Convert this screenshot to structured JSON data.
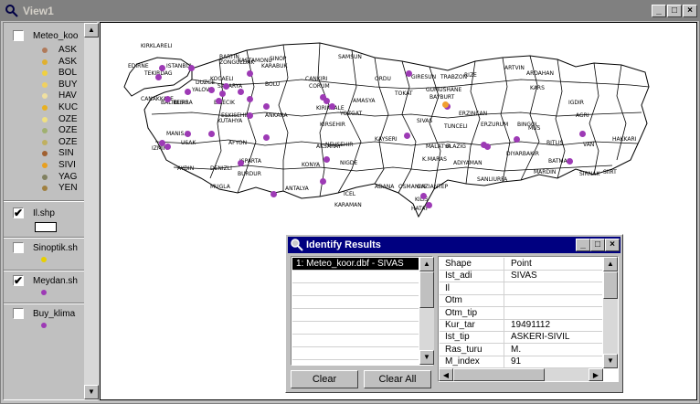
{
  "window": {
    "title": "View1"
  },
  "toc": {
    "layers": [
      {
        "label": "Meteo_koo",
        "checked": false
      },
      {
        "label": "Il.shp",
        "checked": true
      },
      {
        "label": "Sinoptik.sh",
        "checked": false
      },
      {
        "label": "Meydan.sh",
        "checked": true
      },
      {
        "label": "Buy_klima",
        "checked": false
      }
    ],
    "meteo_classes": [
      {
        "label": "ASK",
        "color": "#b07a5a"
      },
      {
        "label": "ASK",
        "color": "#e0b030"
      },
      {
        "label": "BOL",
        "color": "#f0d040"
      },
      {
        "label": "BUY",
        "color": "#f0d060"
      },
      {
        "label": "HAV",
        "color": "#f0e0a0"
      },
      {
        "label": "KUC",
        "color": "#e8b020"
      },
      {
        "label": "OZE",
        "color": "#f0e080"
      },
      {
        "label": "OZE",
        "color": "#a0b070"
      },
      {
        "label": "OZE",
        "color": "#c0b060"
      },
      {
        "label": "SIN",
        "color": "#a06030"
      },
      {
        "label": "SIVI",
        "color": "#e8a020"
      },
      {
        "label": "YAG",
        "color": "#808060"
      },
      {
        "label": "YEN",
        "color": "#a08040"
      }
    ],
    "check_mark": "✔"
  },
  "map": {
    "provinces": [
      "KIRKLARELI",
      "EDIRNE",
      "TEKIRDAG",
      "ISTANBUL",
      "KOCAELI",
      "SAKARYA",
      "BARTIN",
      "ZONGULDAK",
      "KASTAMONU",
      "SINOP",
      "SAMSUN",
      "ORDU",
      "GIRESUN",
      "TRABZON",
      "RIZE",
      "ARTVIN",
      "ARDAHAN",
      "KARS",
      "IGDIR",
      "AGRI",
      "VAN",
      "HAKKARI",
      "SIIRT",
      "SIRNAK",
      "MARDIN",
      "BATMAN",
      "BITLIS",
      "MUS",
      "BINGOL",
      "ERZURUM",
      "ERZINCAN",
      "BAYBURT",
      "GUMUSHANE",
      "TUNCELI",
      "ELAZIG",
      "DIYARBAKIR",
      "SANLIURFA",
      "ADIYAMAN",
      "MALATYA",
      "K.MARAS",
      "GAZIANTEP",
      "KILIS",
      "HATAY",
      "OSMANIYE",
      "ADANA",
      "ICEL",
      "KARAMAN",
      "KONYA",
      "ANTALYA",
      "BURDUR",
      "ISPARTA",
      "MUGLA",
      "DENIZLI",
      "AYDIN",
      "IZMIR",
      "MANISA",
      "USAK",
      "AFYON",
      "KUTAHYA",
      "BALIKESIR",
      "CANAKKALE",
      "BURSA",
      "BILECIK",
      "ESKISEHIR",
      "ANKARA",
      "BOLU",
      "DUZCE",
      "KARABUK",
      "CANKIRI",
      "CORUM",
      "AMASYA",
      "TOKAT",
      "SIVAS",
      "YOZGAT",
      "KIRIKKALE",
      "KIRSEHIR",
      "NEVSEHIR",
      "KAYSERI",
      "AKSARAY",
      "NIGDE",
      "YALOVA"
    ]
  },
  "identify": {
    "title": "Identify Results",
    "list_items": [
      "1: Meteo_koor.dbf - SIVAS"
    ],
    "attributes": [
      {
        "key": "Shape",
        "value": "Point"
      },
      {
        "key": "Ist_adi",
        "value": "SIVAS"
      },
      {
        "key": "Il",
        "value": ""
      },
      {
        "key": "Otm",
        "value": ""
      },
      {
        "key": "Otm_tip",
        "value": ""
      },
      {
        "key": "Kur_tar",
        "value": "19491112"
      },
      {
        "key": "Ist_tip",
        "value": "ASKERI-SIVIL"
      },
      {
        "key": "Ras_turu",
        "value": "M."
      },
      {
        "key": "M_index",
        "value": "91"
      }
    ],
    "clear_label": "Clear",
    "clear_all_label": "Clear All"
  },
  "colors": {
    "point": "#9d3ab5",
    "selected_point": "#f0a030",
    "title_active": "#000080"
  }
}
